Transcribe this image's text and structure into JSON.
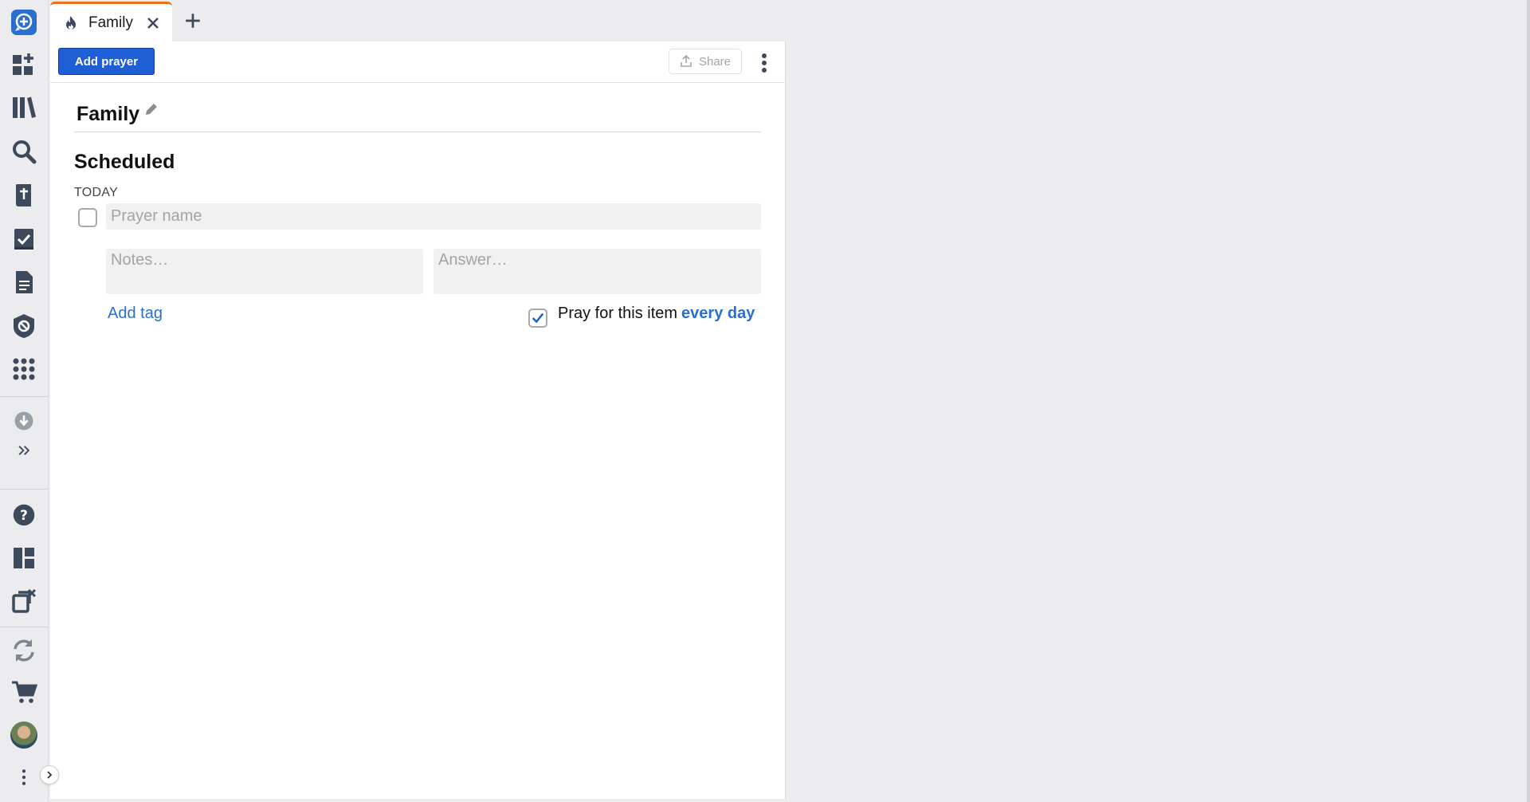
{
  "tab": {
    "label": "Family",
    "icon": "flame-icon",
    "close_icon": "close-icon",
    "accent": "#e8711b"
  },
  "new_tab_icon": "plus-icon",
  "toolbar": {
    "add_prayer_label": "Add prayer",
    "share_label": "Share",
    "share_icon": "upload-icon",
    "more_icon": "vertical-dots-icon"
  },
  "list": {
    "title": "Family",
    "edit_icon": "pencil-icon"
  },
  "section": {
    "heading": "Scheduled",
    "day_label": "TODAY"
  },
  "prayer": {
    "name_value": "",
    "name_placeholder": "Prayer name",
    "notes_placeholder": "Notes…",
    "answer_placeholder": "Answer…",
    "completed": false,
    "add_tag_label": "Add tag",
    "daily_checked": true,
    "daily_text": "Pray for this item",
    "daily_frequency": "every day"
  },
  "sidebar": {
    "items": [
      {
        "icon": "app-logo-icon"
      },
      {
        "icon": "home-add-icon"
      },
      {
        "icon": "library-icon"
      },
      {
        "icon": "search-icon"
      },
      {
        "icon": "bible-icon"
      },
      {
        "icon": "reading-plan-icon"
      },
      {
        "icon": "document-icon"
      },
      {
        "icon": "shield-badge-icon"
      },
      {
        "icon": "apps-grid-icon"
      },
      {
        "icon": "download-icon"
      },
      {
        "icon": "expand-double-chevron-icon"
      },
      {
        "icon": "help-icon"
      },
      {
        "icon": "layout-icon"
      },
      {
        "icon": "close-panels-icon"
      },
      {
        "icon": "sync-icon"
      },
      {
        "icon": "cart-icon"
      },
      {
        "icon": "avatar"
      },
      {
        "icon": "vertical-dots-icon"
      }
    ]
  },
  "colors": {
    "primary": "#1f5fd6",
    "link": "#2a6fce",
    "icon": "#3d4a5c",
    "rail_bg": "#ececee"
  }
}
